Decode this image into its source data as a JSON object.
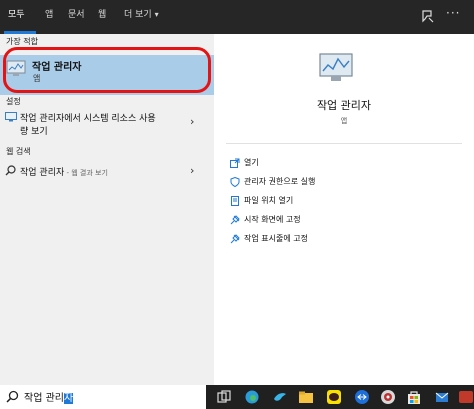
{
  "tabs": [
    "모두",
    "앱",
    "문서",
    "웹",
    "더 보기"
  ],
  "tabs_more_arrow": "▾",
  "sections": {
    "best_match": "가장 적합",
    "settings": "설정",
    "web_search": "웹 검색"
  },
  "best_match": {
    "title": "작업 관리자",
    "subtitle": "앱"
  },
  "settings_result": {
    "line1": "작업 관리자에서 시스템 리소스 사용",
    "line2": "량 보기",
    "chevron": "›"
  },
  "web_result": {
    "title": "작업 관리자",
    "suffix": " - 웹 결과 보기",
    "chevron": "›"
  },
  "preview": {
    "title": "작업 관리자",
    "subtitle": "앱"
  },
  "actions": [
    {
      "label": "열기",
      "icon": "open-icon"
    },
    {
      "label": "관리자 권한으로 실행",
      "icon": "shield-admin-icon"
    },
    {
      "label": "파일 위치 열기",
      "icon": "folder-icon"
    },
    {
      "label": "시작 화면에 고정",
      "icon": "pin-icon"
    },
    {
      "label": "작업 표시줄에 고정",
      "icon": "taskbar-pin-icon"
    }
  ],
  "search": {
    "text_prefix": "작업 관리",
    "text_selected": "자"
  },
  "colors": {
    "accent": "#1f7ad7",
    "highlight": "#a9cce8",
    "annotation_red": "#e51414",
    "taskbar": "#202020"
  }
}
